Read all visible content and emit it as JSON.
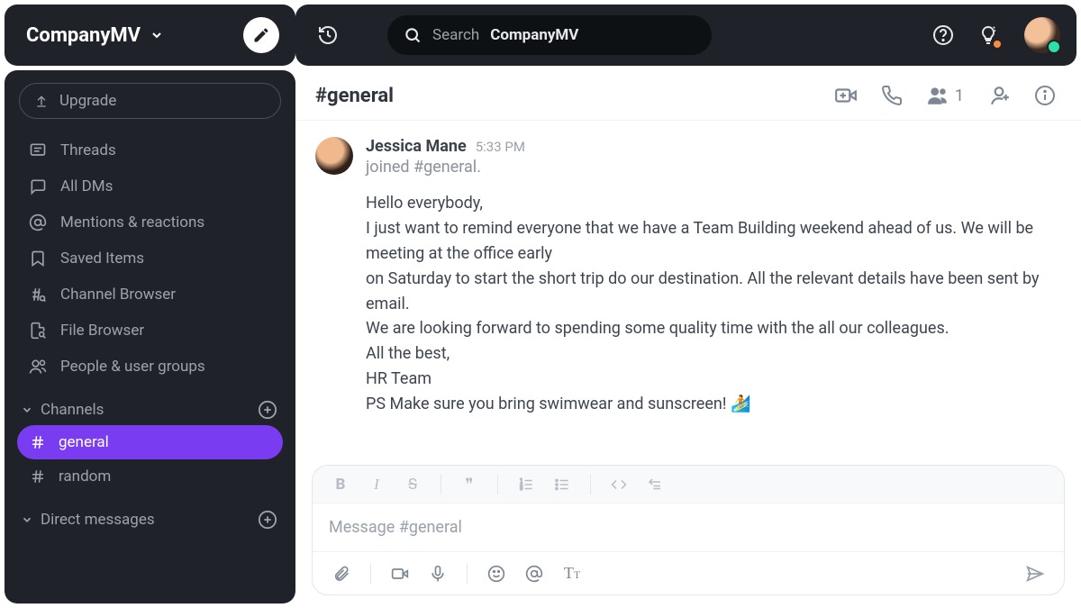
{
  "workspace": {
    "name": "CompanyMV"
  },
  "sidebar": {
    "upgrade_label": "Upgrade",
    "nav": [
      {
        "label": "Threads"
      },
      {
        "label": "All DMs"
      },
      {
        "label": "Mentions & reactions"
      },
      {
        "label": "Saved Items"
      },
      {
        "label": "Channel Browser"
      },
      {
        "label": "File Browser"
      },
      {
        "label": "People & user groups"
      }
    ],
    "sections": {
      "channels": {
        "label": "Channels",
        "items": [
          {
            "name": "general",
            "active": true
          },
          {
            "name": "random",
            "active": false
          }
        ]
      },
      "dms": {
        "label": "Direct messages"
      }
    }
  },
  "topbar": {
    "search_prefix": "Search",
    "search_scope": "CompanyMV"
  },
  "channel": {
    "title": "#general",
    "member_count": "1"
  },
  "message": {
    "author": "Jessica Mane",
    "time": "5:33 PM",
    "system_text": "joined #general.",
    "lines": [
      "Hello everybody,",
      "I just want to remind everyone that we have a Team Building weekend ahead of us. We will be meeting at the office early",
      "on Saturday to start the short trip do our destination. All the relevant details have been sent by email.",
      "We are looking forward to spending some quality time with the all our colleagues.",
      "All the best,",
      "HR Team",
      "PS Make sure you bring swimwear and sunscreen! 🏄"
    ]
  },
  "composer": {
    "placeholder": "Message #general"
  }
}
